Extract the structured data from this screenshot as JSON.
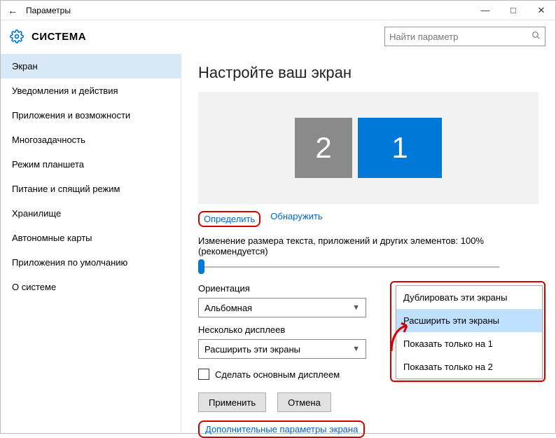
{
  "window": {
    "title": "Параметры",
    "section": "СИСТЕМА"
  },
  "search": {
    "placeholder": "Найти параметр"
  },
  "sidebar": {
    "items": [
      {
        "label": "Экран"
      },
      {
        "label": "Уведомления и действия"
      },
      {
        "label": "Приложения и возможности"
      },
      {
        "label": "Многозадачность"
      },
      {
        "label": "Режим планшета"
      },
      {
        "label": "Питание и спящий режим"
      },
      {
        "label": "Хранилище"
      },
      {
        "label": "Автономные карты"
      },
      {
        "label": "Приложения по умолчанию"
      },
      {
        "label": "О системе"
      }
    ]
  },
  "page": {
    "title": "Настройте ваш экран",
    "monitors": {
      "m1": "1",
      "m2": "2"
    },
    "identify": "Определить",
    "detect": "Обнаружить",
    "scale_label": "Изменение размера текста, приложений и других элементов: 100% (рекомендуется)",
    "orientation_label": "Ориентация",
    "orientation_value": "Альбомная",
    "multi_label": "Несколько дисплеев",
    "multi_value": "Расширить эти экраны",
    "make_main": "Сделать основным дисплеем",
    "apply": "Применить",
    "cancel": "Отмена",
    "advanced": "Дополнительные параметры экрана"
  },
  "popup": {
    "opt0": "Дублировать эти экраны",
    "opt1": "Расширить эти экраны",
    "opt2": "Показать только на 1",
    "opt3": "Показать только на 2"
  }
}
